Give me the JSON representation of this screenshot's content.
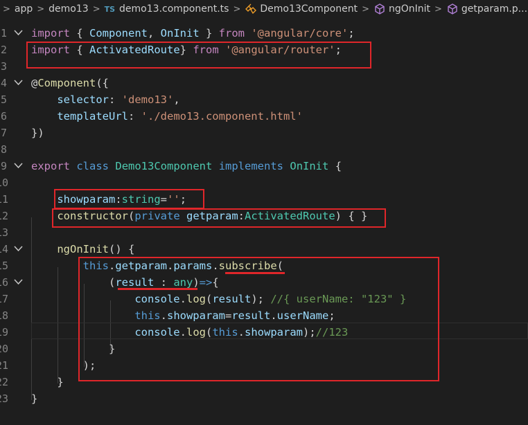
{
  "breadcrumb": {
    "items": [
      "app",
      "demo13",
      "demo13.component.ts",
      "Demo13Component",
      "ngOnInit",
      "getparam.p..."
    ],
    "ts_badge": "TS",
    "separator": ">"
  },
  "colors": {
    "background": "#1e1e1e",
    "keyword": "#c586c0",
    "storage": "#569cd6",
    "class": "#4ec9b0",
    "variable": "#9cdcfe",
    "string": "#ce9178",
    "function": "#dcdcaa",
    "comment": "#6a9955",
    "annotation": "#e0262a"
  },
  "icons": [
    "ts-file-icon",
    "class-symbol-icon",
    "method-symbol-icon",
    "chevron-down-icon"
  ],
  "lines": [
    {
      "n": "1",
      "fold": true,
      "tokens": [
        [
          "kw",
          "import"
        ],
        [
          "pn",
          " { "
        ],
        [
          "var",
          "Component"
        ],
        [
          "pn",
          ", "
        ],
        [
          "var",
          "OnInit"
        ],
        [
          "pn",
          " } "
        ],
        [
          "kw",
          "from"
        ],
        [
          "pn",
          " "
        ],
        [
          "str",
          "'@angular/core'"
        ],
        [
          "pn",
          ";"
        ]
      ]
    },
    {
      "n": "2",
      "fold": false,
      "tokens": [
        [
          "kw",
          "import"
        ],
        [
          "pn",
          " { "
        ],
        [
          "var",
          "ActivatedRoute"
        ],
        [
          "pn",
          "} "
        ],
        [
          "kw",
          "from"
        ],
        [
          "pn",
          " "
        ],
        [
          "str",
          "'@angular/router'"
        ],
        [
          "pn",
          ";"
        ]
      ]
    },
    {
      "n": "3",
      "fold": false,
      "tokens": []
    },
    {
      "n": "4",
      "fold": true,
      "tokens": [
        [
          "pn",
          "@"
        ],
        [
          "fn",
          "Component"
        ],
        [
          "pn",
          "({"
        ]
      ]
    },
    {
      "n": "5",
      "fold": false,
      "tokens": [
        [
          "pn",
          "    "
        ],
        [
          "var",
          "selector"
        ],
        [
          "pn",
          ": "
        ],
        [
          "str",
          "'demo13'"
        ],
        [
          "pn",
          ","
        ]
      ]
    },
    {
      "n": "6",
      "fold": false,
      "tokens": [
        [
          "pn",
          "    "
        ],
        [
          "var",
          "templateUrl"
        ],
        [
          "pn",
          ": "
        ],
        [
          "str",
          "'./demo13.component.html'"
        ]
      ]
    },
    {
      "n": "7",
      "fold": false,
      "tokens": [
        [
          "pn",
          "})"
        ]
      ]
    },
    {
      "n": "8",
      "fold": false,
      "tokens": []
    },
    {
      "n": "9",
      "fold": true,
      "tokens": [
        [
          "kw",
          "export"
        ],
        [
          "pn",
          " "
        ],
        [
          "kw2",
          "class"
        ],
        [
          "pn",
          " "
        ],
        [
          "cls",
          "Demo13Component"
        ],
        [
          "pn",
          " "
        ],
        [
          "kw2",
          "implements"
        ],
        [
          "pn",
          " "
        ],
        [
          "cls",
          "OnInit"
        ],
        [
          "pn",
          " {"
        ]
      ]
    },
    {
      "n": "10",
      "fold": false,
      "tokens": []
    },
    {
      "n": "11",
      "fold": false,
      "tokens": [
        [
          "pn",
          "    "
        ],
        [
          "var",
          "showparam"
        ],
        [
          "pn",
          ":"
        ],
        [
          "cls",
          "string"
        ],
        [
          "pn",
          "="
        ],
        [
          "str",
          "''"
        ],
        [
          "pn",
          ";"
        ]
      ]
    },
    {
      "n": "12",
      "fold": false,
      "tokens": [
        [
          "pn",
          "    "
        ],
        [
          "fn",
          "constructor"
        ],
        [
          "pn",
          "("
        ],
        [
          "kw2",
          "private"
        ],
        [
          "pn",
          " "
        ],
        [
          "var",
          "getparam"
        ],
        [
          "pn",
          ":"
        ],
        [
          "cls",
          "ActivatedRoute"
        ],
        [
          "pn",
          ") { }"
        ]
      ]
    },
    {
      "n": "13",
      "fold": false,
      "tokens": []
    },
    {
      "n": "14",
      "fold": true,
      "tokens": [
        [
          "pn",
          "    "
        ],
        [
          "fn",
          "ngOnInit"
        ],
        [
          "pn",
          "() {"
        ]
      ]
    },
    {
      "n": "15",
      "fold": false,
      "tokens": [
        [
          "pn",
          "        "
        ],
        [
          "kw2",
          "this"
        ],
        [
          "pn",
          "."
        ],
        [
          "var",
          "getparam"
        ],
        [
          "pn",
          "."
        ],
        [
          "var",
          "params"
        ],
        [
          "pn",
          "."
        ],
        [
          "fn",
          "subscribe"
        ],
        [
          "pn",
          "("
        ]
      ]
    },
    {
      "n": "16",
      "fold": true,
      "tokens": [
        [
          "pn",
          "            ("
        ],
        [
          "var",
          "result"
        ],
        [
          "pn",
          " : "
        ],
        [
          "cls",
          "any"
        ],
        [
          "pn",
          ")"
        ],
        [
          "kw2",
          "=>"
        ],
        [
          "pn",
          "{"
        ]
      ]
    },
    {
      "n": "17",
      "fold": false,
      "tokens": [
        [
          "pn",
          "                "
        ],
        [
          "var",
          "console"
        ],
        [
          "pn",
          "."
        ],
        [
          "fn",
          "log"
        ],
        [
          "pn",
          "("
        ],
        [
          "var",
          "result"
        ],
        [
          "pn",
          "); "
        ],
        [
          "cm",
          "//{ userName: \"123\" }"
        ]
      ]
    },
    {
      "n": "18",
      "fold": false,
      "tokens": [
        [
          "pn",
          "                "
        ],
        [
          "kw2",
          "this"
        ],
        [
          "pn",
          "."
        ],
        [
          "var",
          "showparam"
        ],
        [
          "pn",
          "="
        ],
        [
          "var",
          "result"
        ],
        [
          "pn",
          "."
        ],
        [
          "var",
          "userName"
        ],
        [
          "pn",
          ";"
        ]
      ]
    },
    {
      "n": "19",
      "fold": false,
      "tokens": [
        [
          "pn",
          "                "
        ],
        [
          "var",
          "console"
        ],
        [
          "pn",
          "."
        ],
        [
          "fn",
          "log"
        ],
        [
          "pn",
          "("
        ],
        [
          "kw2",
          "this"
        ],
        [
          "pn",
          "."
        ],
        [
          "var",
          "showparam"
        ],
        [
          "pn",
          ");"
        ],
        [
          "cm",
          "//123"
        ]
      ]
    },
    {
      "n": "20",
      "fold": false,
      "tokens": [
        [
          "pn",
          "            }"
        ]
      ]
    },
    {
      "n": "21",
      "fold": false,
      "tokens": [
        [
          "pn",
          "        );"
        ]
      ]
    },
    {
      "n": "22",
      "fold": false,
      "tokens": [
        [
          "pn",
          "    }"
        ]
      ]
    },
    {
      "n": "23",
      "fold": false,
      "tokens": [
        [
          "pn",
          "}"
        ]
      ]
    }
  ]
}
